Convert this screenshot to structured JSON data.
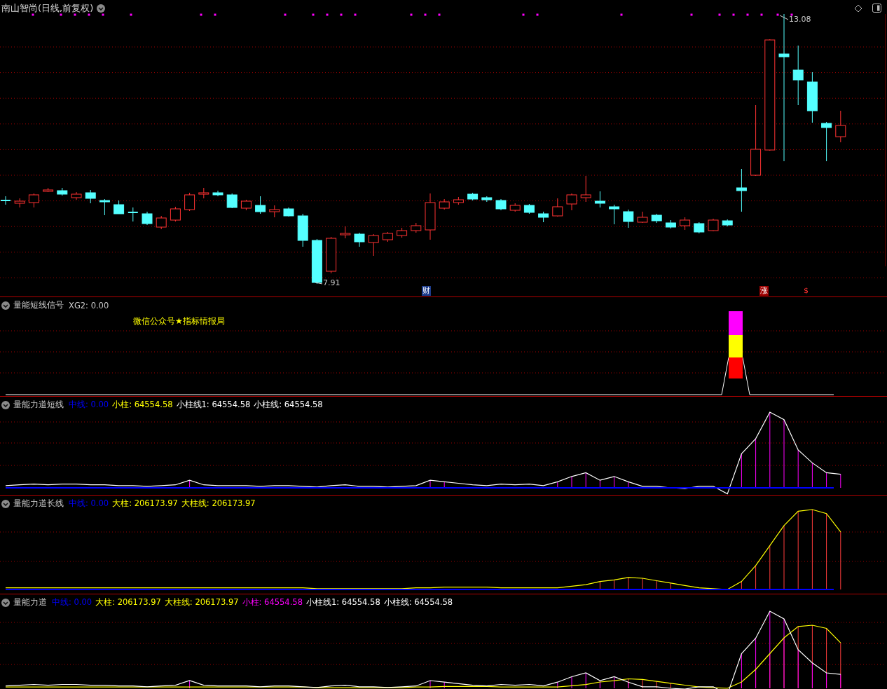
{
  "chart": {
    "title": "南山智尚(日线,前复权)",
    "high_label": "13.08",
    "low_label": "7.91",
    "markers": [
      {
        "text": "财",
        "kind": "finance"
      },
      {
        "text": "涨",
        "kind": "limit"
      },
      {
        "text": "$",
        "kind": "dollar"
      }
    ]
  },
  "panels": [
    {
      "kind": "signal",
      "name": "量能短线信号",
      "readouts": [
        {
          "text": "XG2: 0.00",
          "color": "#c8c8c8"
        }
      ],
      "note": "微信公众号★指标情报局"
    },
    {
      "kind": "short",
      "name": "量能力道短线",
      "readouts": [
        {
          "text": "中线: 0.00",
          "color": "#0000ff"
        },
        {
          "text": "小柱: 64554.58",
          "color": "#ffff00"
        },
        {
          "text": "小柱线1: 64554.58",
          "color": "#ffffff"
        },
        {
          "text": "小柱线: 64554.58",
          "color": "#ffffff"
        }
      ]
    },
    {
      "kind": "long",
      "name": "量能力道长线",
      "readouts": [
        {
          "text": "中线: 0.00",
          "color": "#0000ff"
        },
        {
          "text": "大柱: 206173.97",
          "color": "#ffff00"
        },
        {
          "text": "大柱线: 206173.97",
          "color": "#ffff00"
        }
      ]
    },
    {
      "kind": "combined",
      "name": "量能力道",
      "readouts": [
        {
          "text": "中线: 0.00",
          "color": "#0000ff"
        },
        {
          "text": "大柱: 206173.97",
          "color": "#ffff00"
        },
        {
          "text": "大柱线: 206173.97",
          "color": "#ffff00"
        },
        {
          "text": "小柱: 64554.58",
          "color": "#ff00ff"
        },
        {
          "text": "小柱线1: 64554.58",
          "color": "#ffffff"
        },
        {
          "text": "小柱线: 64554.58",
          "color": "#ffffff"
        }
      ]
    }
  ]
}
